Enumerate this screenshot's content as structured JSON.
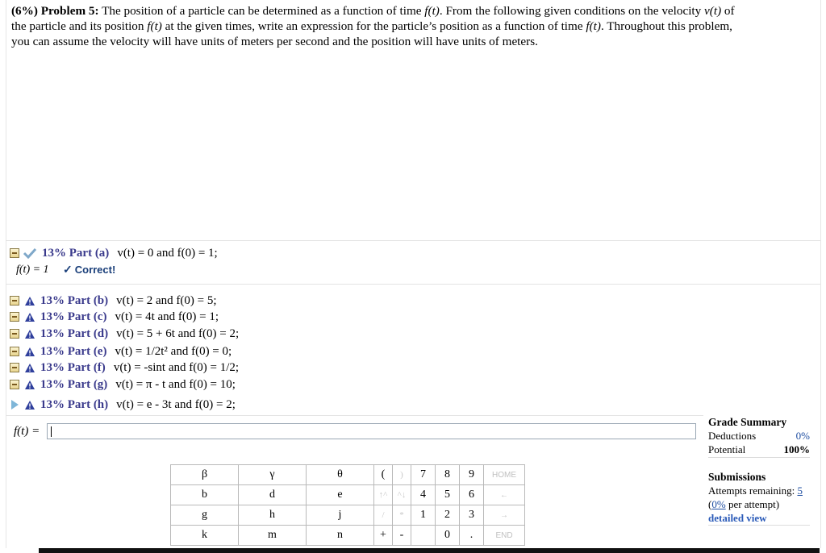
{
  "problem": {
    "lead": "(6%) Problem 5:",
    "text_1": "The position of a particle can be determined as a function of time ",
    "ft": "f(t)",
    "text_2": ". From the following given conditions on the velocity ",
    "vt": "v(t)",
    "text_3": " of the particle and its position ",
    "text_4": " at the given times, write an expression for the particle’s position as a function of time ",
    "text_5": ". Throughout this problem, you can assume the velocity will have units of meters per second and the position will have units of meters."
  },
  "parts": [
    {
      "pct": "13% Part (a)",
      "condition": "v(t) = 0 and f(0) = 1;",
      "status": "correct"
    },
    {
      "pct": "13% Part (b)",
      "condition": "v(t) = 2 and f(0) = 5;",
      "status": "warning"
    },
    {
      "pct": "13% Part (c)",
      "condition": "v(t) = 4t and f(0) = 1;",
      "status": "warning"
    },
    {
      "pct": "13% Part (d)",
      "condition": "v(t) = 5 + 6t and f(0) = 2;",
      "status": "warning"
    },
    {
      "pct": "13% Part (e)",
      "condition": "v(t) = 1/2t² and f(0) = 0;",
      "status": "warning"
    },
    {
      "pct": "13% Part (f)",
      "condition": "v(t) = -sint and f(0) = 1/2;",
      "status": "warning"
    },
    {
      "pct": "13% Part (g)",
      "condition": "v(t) = π - t and f(0) = 10;",
      "status": "warning"
    },
    {
      "pct": "13% Part (h)",
      "condition": "v(t) = e - 3t and f(0) = 2;",
      "status": "warning"
    }
  ],
  "part_a": {
    "answer": "f(t) = 1",
    "feedback": "Correct!"
  },
  "answer_input": {
    "label": "f(t) =",
    "value": ""
  },
  "grade_summary": {
    "title": "Grade Summary",
    "deductions_label": "Deductions",
    "deductions_value": "0%",
    "potential_label": "Potential",
    "potential_value": "100%"
  },
  "submissions": {
    "title": "Submissions",
    "attempts_label": "Attempts remaining:",
    "attempts_value": "5",
    "per_attempt_value": "0%",
    "per_attempt_text": " per attempt)",
    "detailed": "detailed view"
  },
  "keypad": {
    "greek": [
      [
        "β",
        "γ",
        "θ"
      ],
      [
        "b",
        "d",
        "e"
      ],
      [
        "g",
        "h",
        "j"
      ],
      [
        "k",
        "m",
        "n"
      ]
    ],
    "ops": [
      [
        "(",
        ")"
      ],
      [
        "↑^",
        "^↓"
      ],
      [
        "/",
        "*"
      ],
      [
        "+",
        "-"
      ]
    ],
    "digits": [
      [
        "7",
        "8",
        "9"
      ],
      [
        "4",
        "5",
        "6"
      ],
      [
        "1",
        "2",
        "3"
      ],
      [
        "",
        "0",
        "."
      ]
    ],
    "nav": [
      "HOME",
      "←",
      "→",
      "END"
    ]
  },
  "colors": {
    "part_label": "#3a3a8c",
    "link": "#1e4da1",
    "correct": "#1a3f7a"
  }
}
